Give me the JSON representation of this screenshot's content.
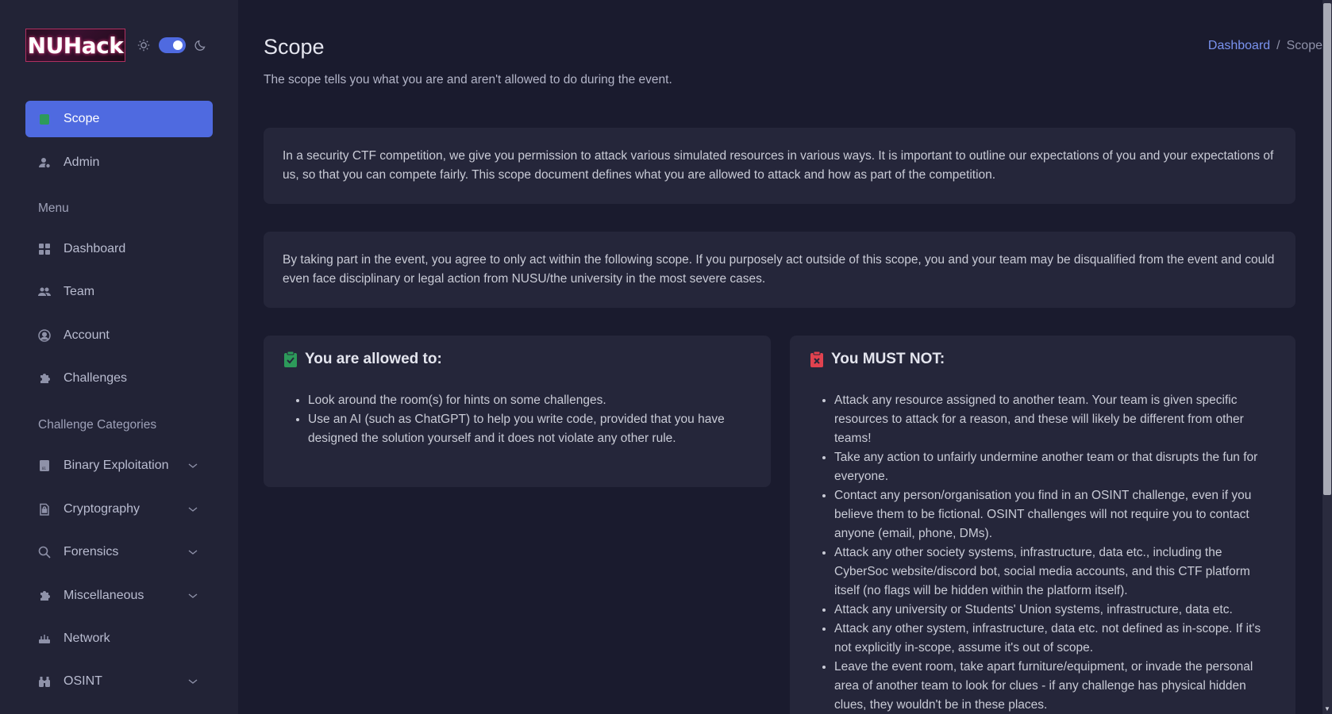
{
  "brand": {
    "logo_text": "NUHack"
  },
  "sidebar": {
    "top_items": [
      {
        "label": "Scope",
        "icon": "clipboard-icon",
        "active": true
      },
      {
        "label": "Admin",
        "icon": "user-cog-icon"
      }
    ],
    "menu_label": "Menu",
    "menu_items": [
      {
        "label": "Dashboard",
        "icon": "grid-icon"
      },
      {
        "label": "Team",
        "icon": "users-icon"
      },
      {
        "label": "Account",
        "icon": "user-circle-icon"
      },
      {
        "label": "Challenges",
        "icon": "puzzle-icon"
      }
    ],
    "categories_label": "Challenge Categories",
    "category_items": [
      {
        "label": "Binary Exploitation",
        "icon": "binary-file-icon",
        "expandable": true
      },
      {
        "label": "Cryptography",
        "icon": "lock-file-icon",
        "expandable": true
      },
      {
        "label": "Forensics",
        "icon": "search-icon",
        "expandable": true
      },
      {
        "label": "Miscellaneous",
        "icon": "puzzle-icon",
        "expandable": true
      },
      {
        "label": "Network",
        "icon": "router-icon",
        "expandable": false
      },
      {
        "label": "OSINT",
        "icon": "binoculars-icon",
        "expandable": true
      }
    ]
  },
  "header": {
    "title": "Scope",
    "subtitle": "The scope tells you what you are and aren't allowed to do during the event.",
    "breadcrumb": {
      "link": "Dashboard",
      "separator": "/",
      "current": "Scope"
    }
  },
  "intro": {
    "paragraph1": "In a security CTF competition, we give you permission to attack various simulated resources in various ways. It is important to outline our expectations of you and your expectations of us, so that you can compete fairly. This scope document defines what you are allowed to attack and how as part of the competition.",
    "paragraph2": "By taking part in the event, you agree to only act within the following scope. If you purposely act outside of this scope, you and your team may be disqualified from the event and could even face disciplinary or legal action from NUSU/the university in the most severe cases."
  },
  "allowed": {
    "title": "You are allowed to:",
    "icon": "clipboard-check-icon",
    "color": "#2d9a5a",
    "items": [
      "Look around the room(s) for hints on some challenges.",
      "Use an AI (such as ChatGPT) to help you write code, provided that you have designed the solution yourself and it does not violate any other rule."
    ]
  },
  "forbidden": {
    "title": "You MUST NOT:",
    "icon": "clipboard-x-icon",
    "color": "#e0424f",
    "items": [
      "Attack any resource assigned to another team. Your team is given specific resources to attack for a reason, and these will likely be different from other teams!",
      "Take any action to unfairly undermine another team or that disrupts the fun for everyone.",
      "Contact any person/organisation you find in an OSINT challenge, even if you believe them to be fictional. OSINT challenges will not require you to contact anyone (email, phone, DMs).",
      "Attack any other society systems, infrastructure, data etc., including the CyberSoc website/discord bot, social media accounts, and this CTF platform itself (no flags will be hidden within the platform itself).",
      "Attack any university or Students' Union systems, infrastructure, data etc.",
      "Attack any other system, infrastructure, data etc. not defined as in-scope. If it's not explicitly in-scope, assume it's out of scope.",
      "Leave the event room, take apart furniture/equipment, or invade the personal area of another team to look for clues - if any challenge has physical hidden clues, they wouldn't be in these places."
    ]
  },
  "colors": {
    "accent": "#4f6ae0",
    "background": "#1a1b2e",
    "sidebar": "#222336",
    "card": "#25263a"
  }
}
